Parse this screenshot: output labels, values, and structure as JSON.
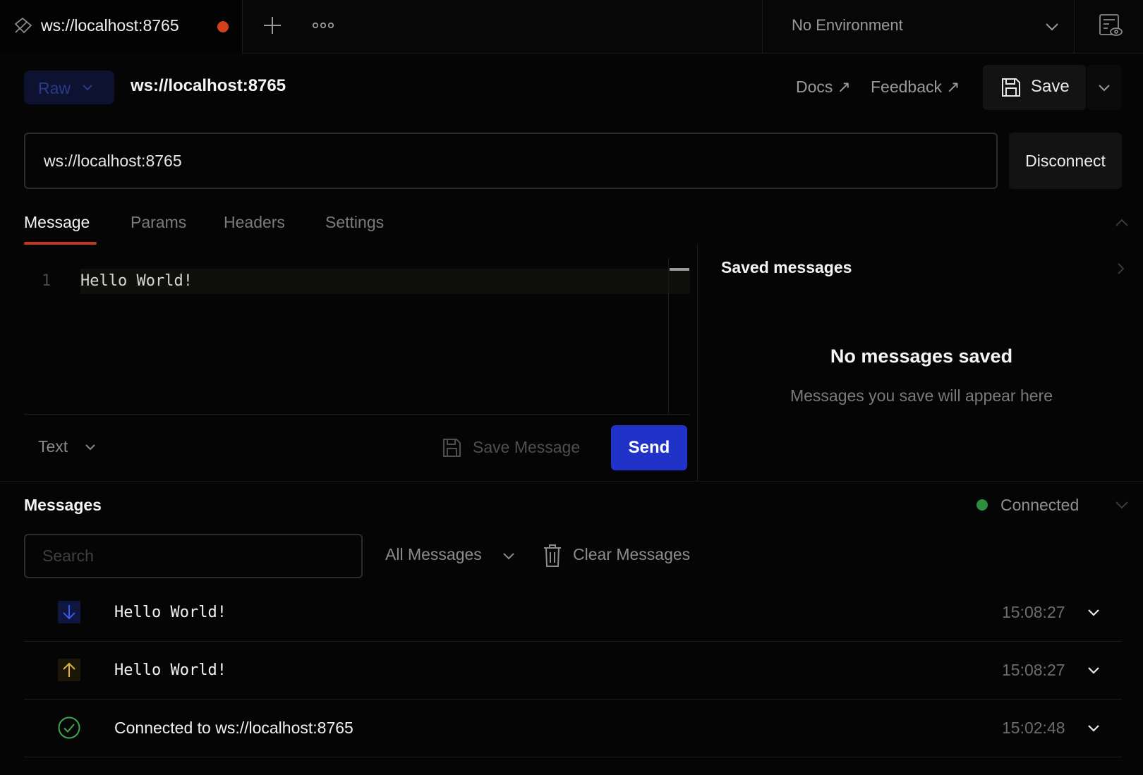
{
  "tabs": [
    {
      "title": "ws://localhost:8765",
      "unsaved": true
    }
  ],
  "environment": {
    "label": "No Environment"
  },
  "request": {
    "mode": "Raw",
    "title": "ws://localhost:8765",
    "docs_label": "Docs ↗",
    "feedback_label": "Feedback ↗",
    "save_label": "Save",
    "url": "ws://localhost:8765",
    "disconnect_label": "Disconnect",
    "tabs": [
      "Message",
      "Params",
      "Headers",
      "Settings"
    ],
    "active_tab": "Message"
  },
  "editor": {
    "line_number": "1",
    "content": "Hello World!",
    "format": "Text",
    "save_message_label": "Save Message",
    "send_label": "Send"
  },
  "saved_messages": {
    "title": "Saved messages",
    "empty_title": "No messages saved",
    "empty_subtitle": "Messages you save will appear here"
  },
  "messages": {
    "title": "Messages",
    "status": "Connected",
    "status_color": "#2d8f3c",
    "search_placeholder": "Search",
    "filter": "All Messages",
    "clear_label": "Clear Messages",
    "items": [
      {
        "direction": "incoming",
        "icon": "arrow-down-icon",
        "text": "Hello World!",
        "time": "15:08:27"
      },
      {
        "direction": "outgoing",
        "icon": "arrow-up-icon",
        "text": "Hello World!",
        "time": "15:08:27"
      },
      {
        "direction": "info",
        "icon": "check-circle-icon",
        "text": "Connected to ws://localhost:8765",
        "time": "15:02:48"
      }
    ]
  },
  "colors": {
    "accent": "#2132c9",
    "unsaved_dot": "#d3401d",
    "active_tab_underline": "#c0391a",
    "incoming": "#3b57e6",
    "outgoing": "#e0b43a",
    "success": "#3fa652"
  }
}
